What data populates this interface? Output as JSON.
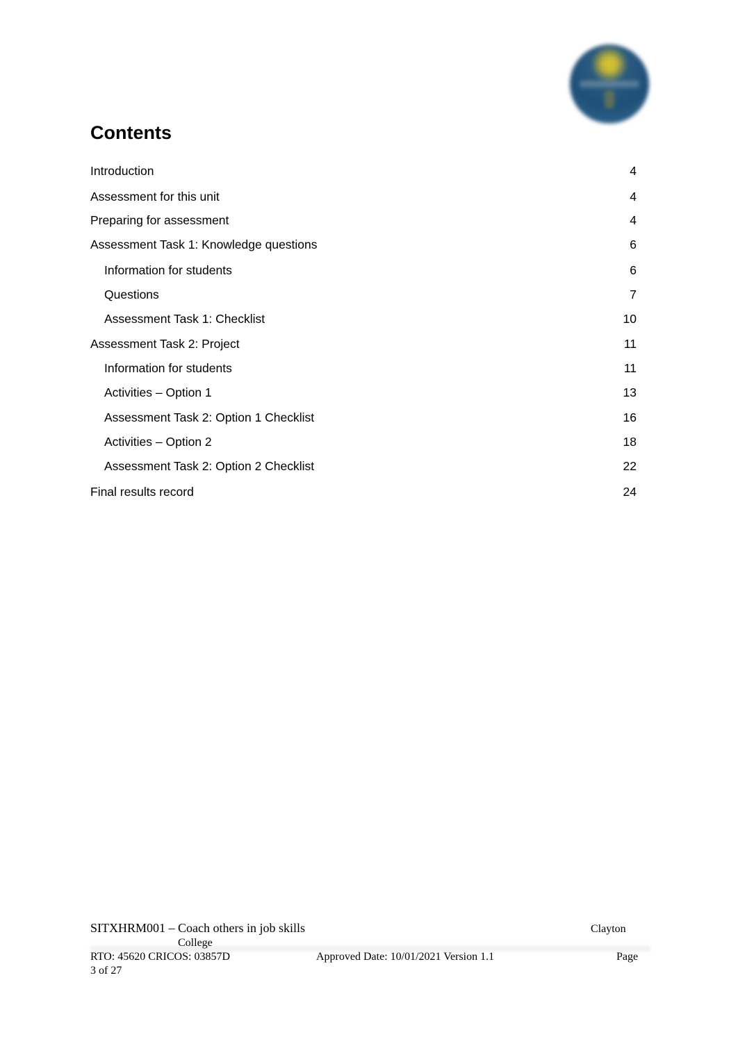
{
  "logo": {
    "icon": "college-logo-icon",
    "colors": {
      "primary": "#1f4f78",
      "accent": "#d8c630"
    }
  },
  "heading": "Contents",
  "toc": [
    {
      "label": "Introduction",
      "page": "4",
      "level": 1
    },
    {
      "label": "Assessment for this unit",
      "page": "4",
      "level": 1
    },
    {
      "label": "Preparing for assessment",
      "page": "4",
      "level": 1
    },
    {
      "label": "Assessment Task 1: Knowledge questions",
      "page": "6",
      "level": 1
    },
    {
      "label": "Information for students",
      "page": "6",
      "level": 2
    },
    {
      "label": "Questions",
      "page": "7",
      "level": 2
    },
    {
      "label": "Assessment Task 1: Checklist",
      "page": "10",
      "level": 2
    },
    {
      "label": "Assessment Task 2: Project",
      "page": "11",
      "level": 1
    },
    {
      "label": "Information for students",
      "page": "11",
      "level": 2
    },
    {
      "label": "Activities – Option 1",
      "page": "13",
      "level": 2
    },
    {
      "label": "Assessment Task 2: Option 1 Checklist",
      "page": "16",
      "level": 2
    },
    {
      "label": "Activities – Option 2",
      "page": "18",
      "level": 2
    },
    {
      "label": "Assessment Task 2: Option 2 Checklist",
      "page": "22",
      "level": 2
    },
    {
      "label": "Final results record",
      "page": "24",
      "level": 1
    }
  ],
  "footer": {
    "unit_title": "SITXHRM001 – Coach others in job skills",
    "college_first": "Clayton",
    "college_second": "College",
    "rto": "RTO: 45620 CRICOS: 03857D",
    "approved": "Approved Date: 10/01/2021 Version 1.1",
    "page_word": "Page",
    "page_count": "3 of 27"
  }
}
